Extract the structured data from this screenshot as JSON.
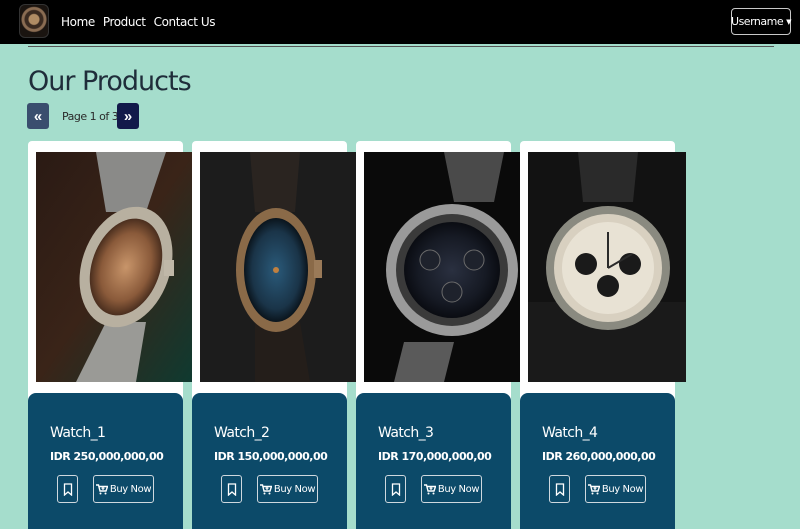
{
  "nav": {
    "links": [
      "Home",
      "Product",
      "Contact Us"
    ],
    "user_label": "Username"
  },
  "page": {
    "title": "Our Products",
    "pager_text": "Page 1 of 3",
    "prev_icon": "«",
    "next_icon": "»"
  },
  "colors": {
    "background": "#a5ddcc",
    "navbar": "#000000",
    "card_body": "#0c4a69",
    "pager_prev": "#3a4e6e",
    "pager_next": "#121a4a"
  },
  "products": [
    {
      "name": "Watch_1",
      "price": "IDR 250,000,000,00",
      "buy_label": "Buy Now"
    },
    {
      "name": "Watch_2",
      "price": "IDR 150,000,000,00",
      "buy_label": "Buy Now"
    },
    {
      "name": "Watch_3",
      "price": "IDR 170,000,000,00",
      "buy_label": "Buy Now"
    },
    {
      "name": "Watch_4",
      "price": "IDR 260,000,000,00",
      "buy_label": "Buy Now"
    }
  ]
}
